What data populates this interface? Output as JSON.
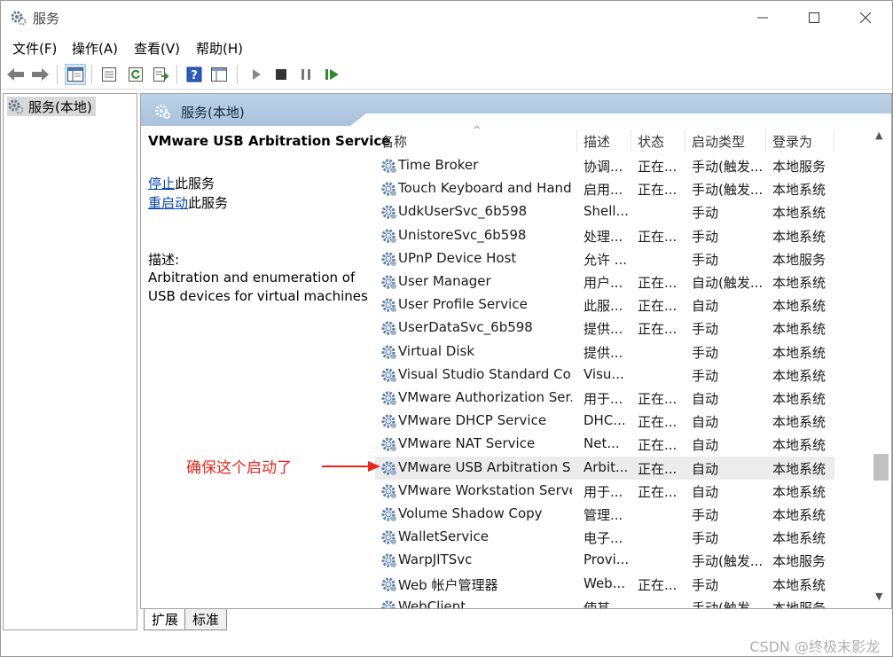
{
  "window": {
    "title": "服务",
    "minimize_label": "—",
    "maximize_label": "☐",
    "close_label": "✕"
  },
  "menu": {
    "items": [
      "文件(F)",
      "操作(A)",
      "查看(V)",
      "帮助(H)"
    ]
  },
  "toolbar": {
    "icons": [
      "back-arrow-icon",
      "forward-arrow-icon",
      "show-hide-tree-icon",
      "properties-icon",
      "refresh-icon",
      "export-list-icon",
      "help-icon",
      "console-icon",
      "start-service-icon",
      "stop-service-icon",
      "pause-service-icon",
      "restart-service-icon"
    ]
  },
  "tree": {
    "item_label": "服务(本地)"
  },
  "header": {
    "title": "服务(本地)"
  },
  "details": {
    "service_name": "VMware USB Arbitration Service",
    "stop_link": "停止",
    "stop_suffix": "此服务",
    "restart_link": "重启动",
    "restart_suffix": "此服务",
    "description_label": "描述:",
    "description_line1": "Arbitration and enumeration of",
    "description_line2": "USB devices for virtual machines"
  },
  "columns": {
    "name": "名称",
    "desc": "描述",
    "status": "状态",
    "startup": "启动类型",
    "logon": "登录为",
    "sort_indicator": "^"
  },
  "rows": [
    {
      "name": "Time Broker",
      "desc": "协调...",
      "status": "正在...",
      "startup": "手动(触发...",
      "logon": "本地服务"
    },
    {
      "name": "Touch Keyboard and Hand...",
      "desc": "启用...",
      "status": "正在...",
      "startup": "手动(触发...",
      "logon": "本地系统"
    },
    {
      "name": "UdkUserSvc_6b598",
      "desc": "Shell...",
      "status": "",
      "startup": "手动",
      "logon": "本地系统"
    },
    {
      "name": "UnistoreSvc_6b598",
      "desc": "处理...",
      "status": "正在...",
      "startup": "手动",
      "logon": "本地系统"
    },
    {
      "name": "UPnP Device Host",
      "desc": "允许 ...",
      "status": "",
      "startup": "手动",
      "logon": "本地服务"
    },
    {
      "name": "User Manager",
      "desc": "用户...",
      "status": "正在...",
      "startup": "自动(触发...",
      "logon": "本地系统"
    },
    {
      "name": "User Profile Service",
      "desc": "此服...",
      "status": "正在...",
      "startup": "自动",
      "logon": "本地系统"
    },
    {
      "name": "UserDataSvc_6b598",
      "desc": "提供...",
      "status": "正在...",
      "startup": "手动",
      "logon": "本地系统"
    },
    {
      "name": "Virtual Disk",
      "desc": "提供...",
      "status": "",
      "startup": "手动",
      "logon": "本地系统"
    },
    {
      "name": "Visual Studio Standard Coll...",
      "desc": "Visu...",
      "status": "",
      "startup": "手动",
      "logon": "本地系统"
    },
    {
      "name": "VMware Authorization Ser...",
      "desc": "用于...",
      "status": "正在...",
      "startup": "自动",
      "logon": "本地系统"
    },
    {
      "name": "VMware DHCP Service",
      "desc": "DHC...",
      "status": "正在...",
      "startup": "自动",
      "logon": "本地系统"
    },
    {
      "name": "VMware NAT Service",
      "desc": "Net...",
      "status": "正在...",
      "startup": "自动",
      "logon": "本地系统"
    },
    {
      "name": "VMware USB Arbitration S...",
      "desc": "Arbit...",
      "status": "正在...",
      "startup": "自动",
      "logon": "本地系统",
      "selected": true
    },
    {
      "name": "VMware Workstation Server",
      "desc": "用于...",
      "status": "正在...",
      "startup": "自动",
      "logon": "本地系统"
    },
    {
      "name": "Volume Shadow Copy",
      "desc": "管理...",
      "status": "",
      "startup": "手动",
      "logon": "本地系统"
    },
    {
      "name": "WalletService",
      "desc": "电子...",
      "status": "",
      "startup": "手动",
      "logon": "本地系统"
    },
    {
      "name": "WarpJITSvc",
      "desc": "Provi...",
      "status": "",
      "startup": "手动(触发...",
      "logon": "本地服务"
    },
    {
      "name": "Web 帐户管理器",
      "desc": "Web...",
      "status": "正在...",
      "startup": "手动",
      "logon": "本地系统"
    },
    {
      "name": "WebClient",
      "desc": "使其...",
      "status": "",
      "startup": "手动(触发...",
      "logon": "本地服务"
    }
  ],
  "tabs": [
    "扩展",
    "标准"
  ],
  "annotation": {
    "text": "确保这个启动了",
    "color": "#e8261c"
  },
  "watermark": "CSDN @终极末影龙"
}
